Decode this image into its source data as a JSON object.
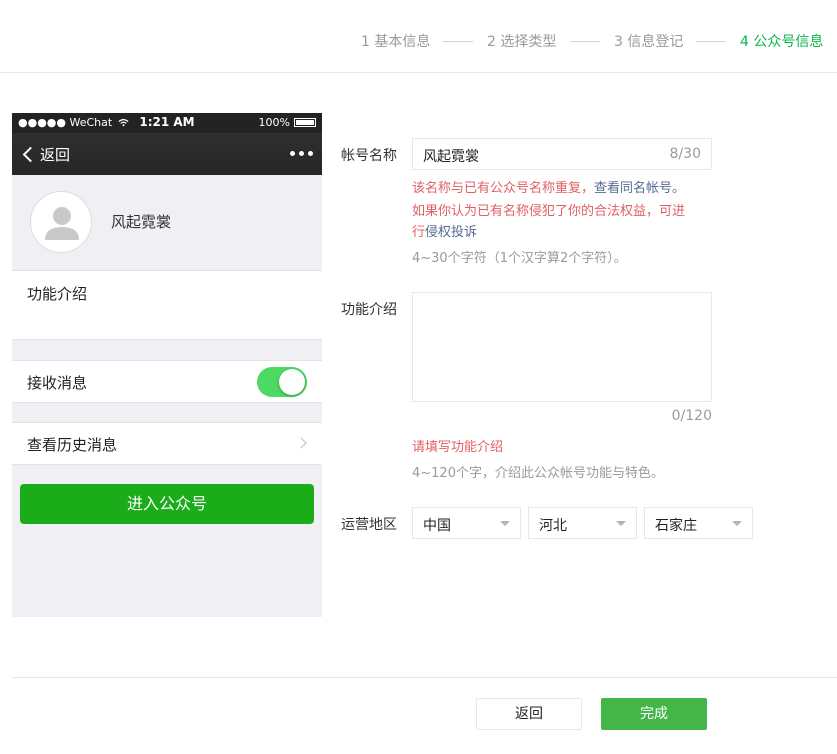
{
  "steps": [
    {
      "label": "1 基本信息"
    },
    {
      "label": "2 选择类型"
    },
    {
      "label": "3 信息登记"
    },
    {
      "label": "4 公众号信息"
    }
  ],
  "colors": {
    "accent": "#07b74a",
    "error": "#e15f63",
    "link": "#576b95",
    "toggle_on": "#4cd964",
    "enter_button": "#1aad19"
  },
  "phone": {
    "status": {
      "carrier": "●●●●● WeChat",
      "time": "1:21 AM",
      "battery": "100%"
    },
    "nav": {
      "back": "返回"
    },
    "profile": {
      "name": "风起霓裳"
    },
    "intro_label": "功能介绍",
    "receive_label": "接收消息",
    "receive_on": true,
    "history_label": "查看历史消息",
    "enter_button": "进入公众号"
  },
  "form": {
    "name_label": "帐号名称",
    "name_value": "风起霓裳",
    "name_count": "8/30",
    "name_err_1": "该名称与已有公众号名称重复，",
    "name_err_link_1": "查看同名帐号。",
    "name_err_2": "如果你认为已有名称侵犯了你的合法权益，可进",
    "name_err_3": "行",
    "name_err_link_2": "侵权投诉",
    "name_tip": "4~30个字符（1个汉字算2个字符）。",
    "intro_label": "功能介绍",
    "intro_value": "",
    "intro_count": "0/120",
    "intro_err": "请填写功能介绍",
    "intro_tip": "4~120个字，介绍此公众帐号功能与特色。",
    "region_label": "运营地区",
    "country": "中国",
    "province": "河北",
    "city": "石家庄"
  },
  "footer": {
    "back": "返回",
    "done": "完成"
  }
}
